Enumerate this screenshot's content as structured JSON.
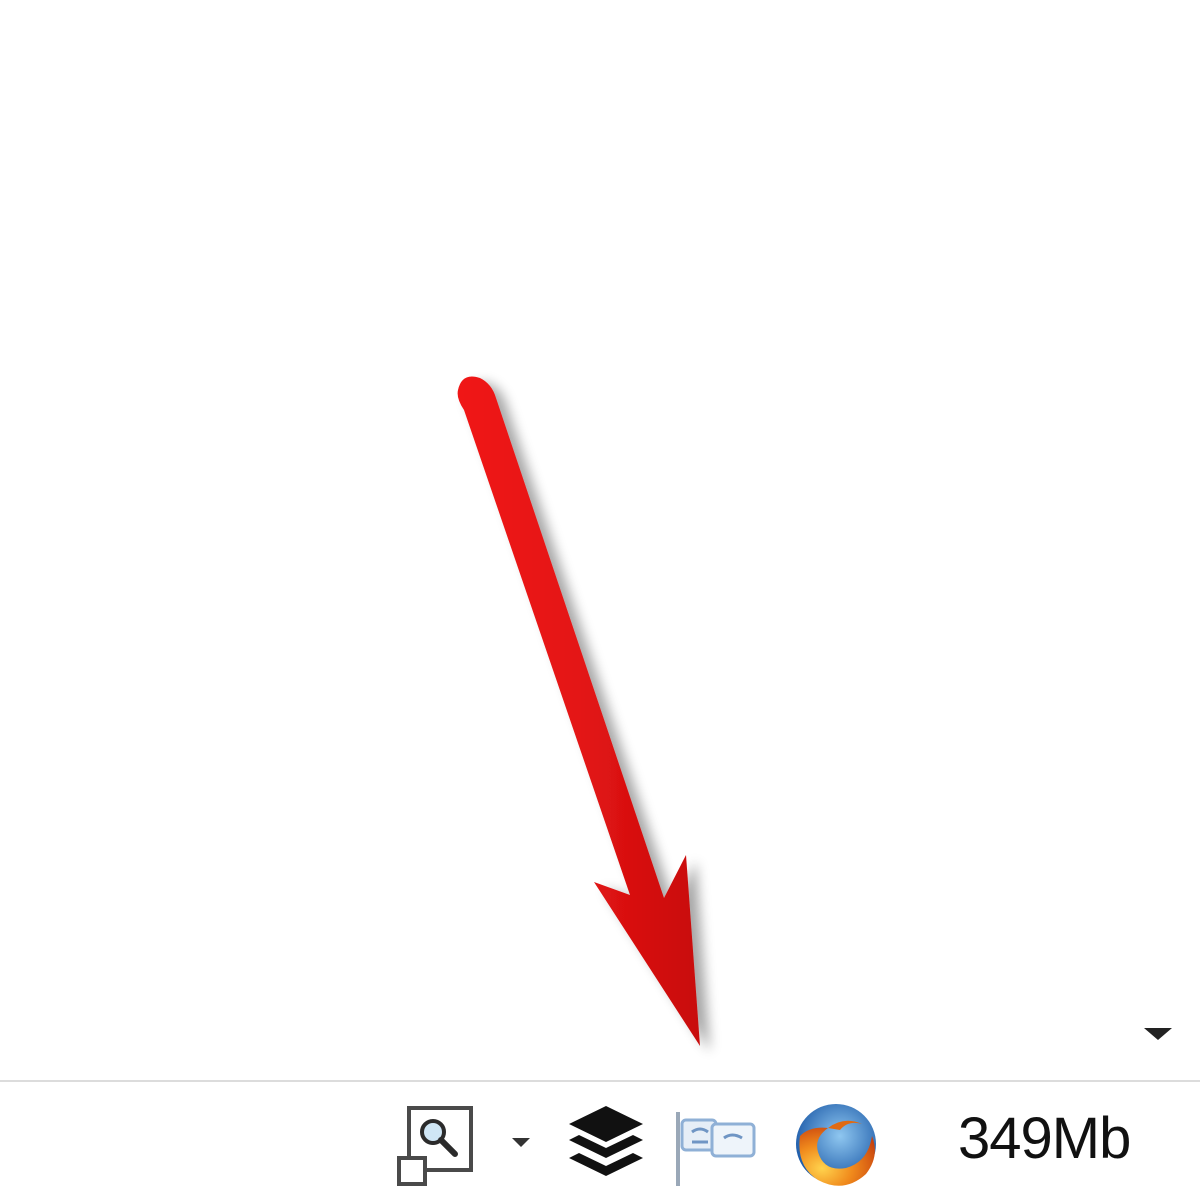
{
  "status_bar": {
    "memory_usage": "349Mb",
    "icons": {
      "zoom": "zoom-icon",
      "dropdown": "chevron-down-icon",
      "layers": "layers-icon",
      "sync": "sync-icon",
      "browser": "firefox-icon",
      "overflow": "chevron-down-icon"
    }
  },
  "annotation": {
    "arrow_color": "#e41414"
  },
  "colors": {
    "background": "#ffffff",
    "divider": "#dcdcdc",
    "text": "#111111"
  }
}
